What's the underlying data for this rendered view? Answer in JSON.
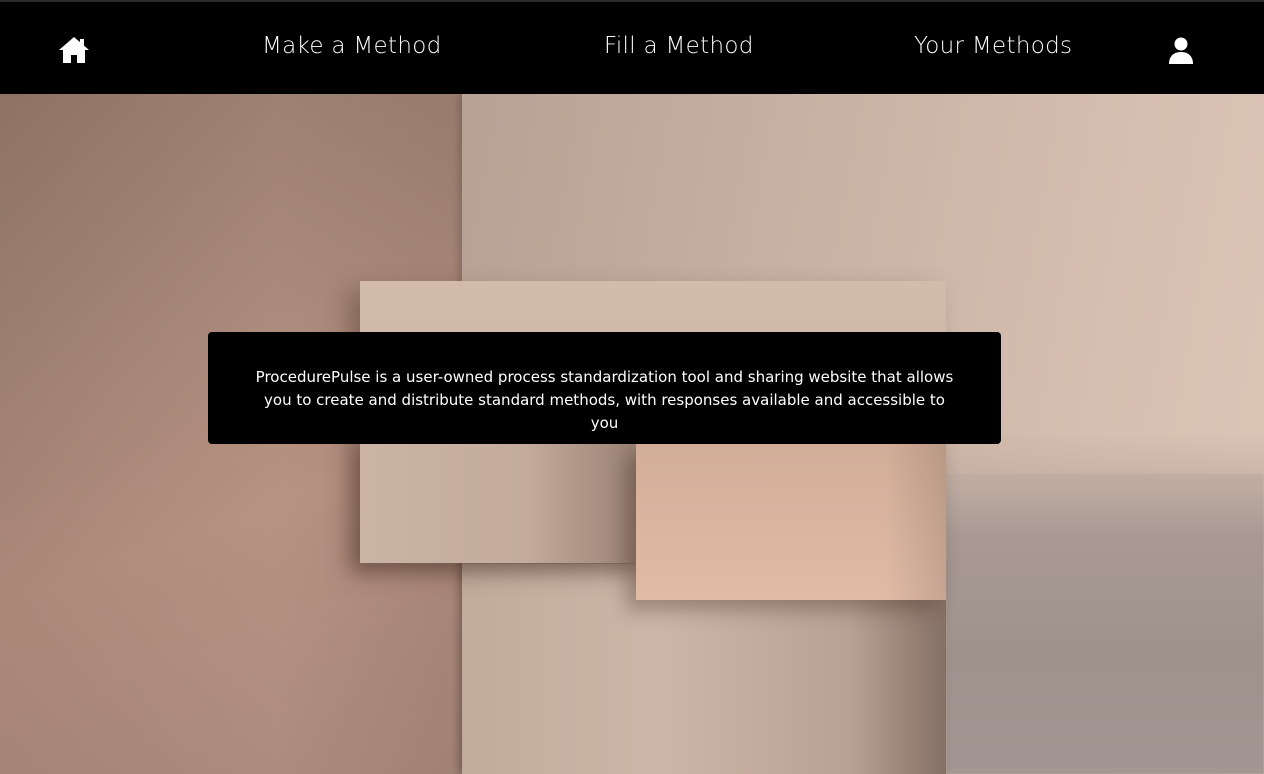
{
  "nav": {
    "home_icon": "home-icon",
    "links": {
      "make": "Make a Method",
      "fill": "Fill a Method",
      "yours": "Your Methods"
    },
    "profile_icon": "user-icon"
  },
  "hero": {
    "description": "ProcedurePulse is a user-owned process standardization tool and sharing website that allows you to create and distribute standard methods, with responses available and accessible to you"
  },
  "colors": {
    "nav_background": "#000000",
    "nav_text": "#ffffff",
    "info_box_background": "#000000",
    "info_box_text": "#ffffff"
  }
}
